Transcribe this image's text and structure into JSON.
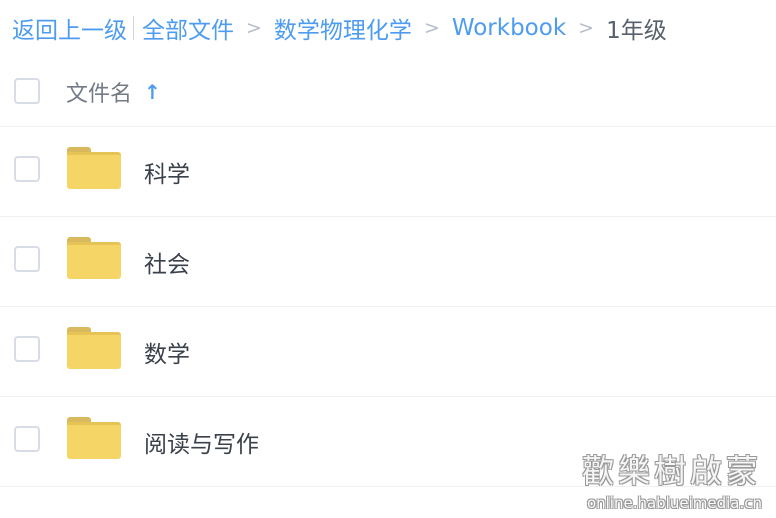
{
  "breadcrumb": {
    "back": "返回上一级",
    "items": [
      "全部文件",
      "数学物理化学",
      "Workbook"
    ],
    "separator": ">",
    "current": "1年级"
  },
  "list_header": {
    "name_label": "文件名",
    "sort_indicator": "↑"
  },
  "rows": [
    {
      "name": "科学",
      "icon": "folder-icon"
    },
    {
      "name": "社会",
      "icon": "folder-icon"
    },
    {
      "name": "数学",
      "icon": "folder-icon"
    },
    {
      "name": "阅读与写作",
      "icon": "folder-icon"
    }
  ],
  "watermark": {
    "title": "歡樂樹啟蒙",
    "url": "online.hablueimedia.cn"
  },
  "colors": {
    "link": "#4e9cf0",
    "folder": "#f5d565",
    "text": "#3b414b"
  }
}
